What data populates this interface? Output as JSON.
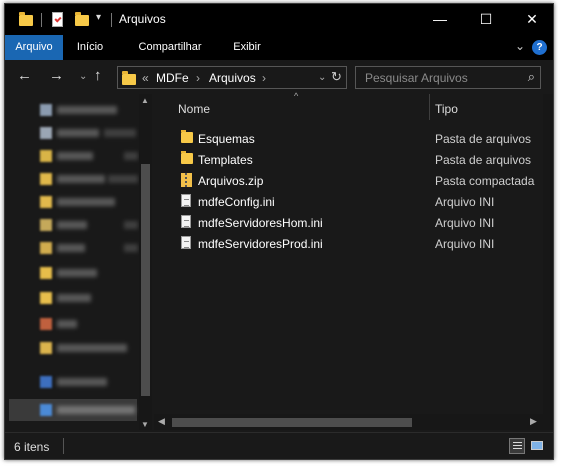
{
  "window": {
    "title": "Arquivos",
    "controls": {
      "minimize": "—",
      "maximize": "☐",
      "close": "✕"
    }
  },
  "ribbon": {
    "tabs": [
      {
        "label": "Arquivo",
        "active": true
      },
      {
        "label": "Início"
      },
      {
        "label": "Compartilhar"
      },
      {
        "label": "Exibir"
      }
    ],
    "help_label": "?"
  },
  "address_bar": {
    "overflow": "«",
    "crumbs": [
      "MDFe",
      "Arquivos"
    ],
    "separator": "›"
  },
  "search": {
    "placeholder": "Pesquisar Arquivos"
  },
  "columns": {
    "name": "Nome",
    "type": "Tipo"
  },
  "files": [
    {
      "name": "Esquemas",
      "type": "Pasta de arquivos",
      "icon": "folder-icon"
    },
    {
      "name": "Templates",
      "type": "Pasta de arquivos",
      "icon": "folder-icon"
    },
    {
      "name": "Arquivos.zip",
      "type": "Pasta compactada",
      "icon": "zip-icon"
    },
    {
      "name": "mdfeConfig.ini",
      "type": "Arquivo INI",
      "icon": "ini-file-icon"
    },
    {
      "name": "mdfeServidoresHom.ini",
      "type": "Arquivo INI",
      "icon": "ini-file-icon"
    },
    {
      "name": "mdfeServidoresProd.ini",
      "type": "Arquivo INI",
      "icon": "ini-file-icon"
    }
  ],
  "status": {
    "item_count": "6 itens"
  },
  "colors": {
    "accent": "#1a67b3",
    "background": "#191919",
    "folder": "#f7c948"
  }
}
